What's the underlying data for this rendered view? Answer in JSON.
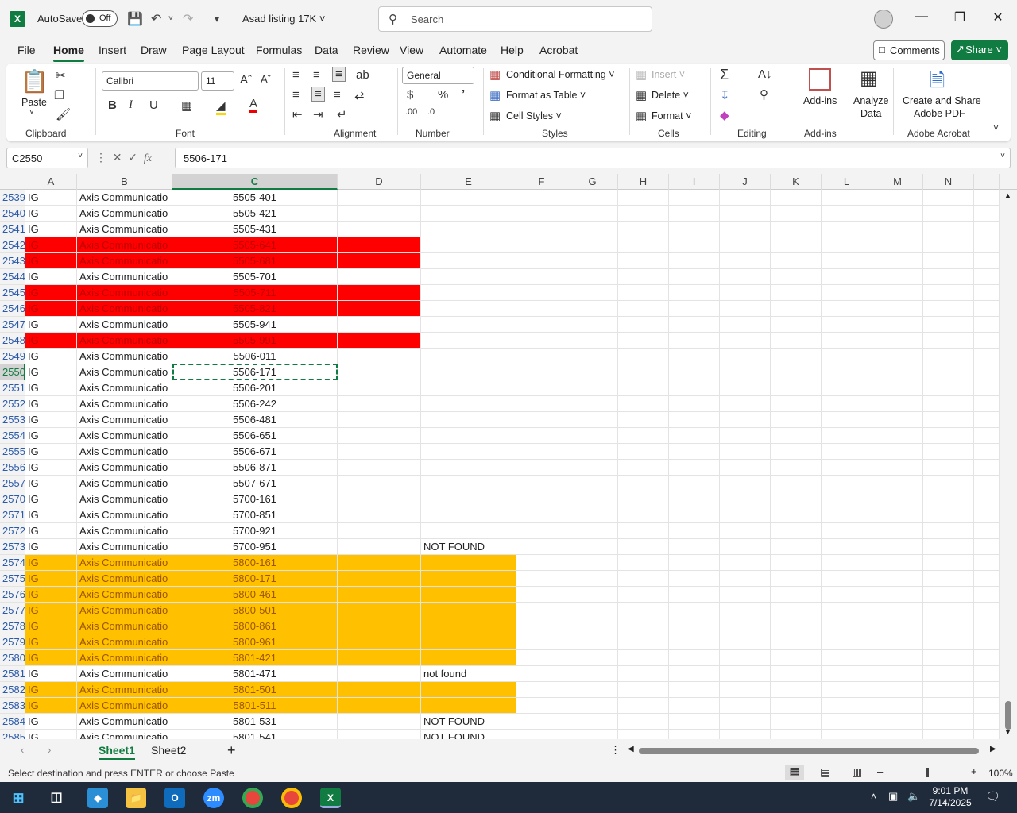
{
  "title": {
    "autosave_label": "AutoSave",
    "autosave_state": "Off",
    "doc_title": "Asad listing 17K",
    "search_placeholder": "Search"
  },
  "menu": {
    "tabs": [
      "File",
      "Home",
      "Insert",
      "Draw",
      "Page Layout",
      "Formulas",
      "Data",
      "Review",
      "View",
      "Automate",
      "Help",
      "Acrobat"
    ],
    "active": "Home",
    "comments": "Comments",
    "share": "Share"
  },
  "ribbon": {
    "clipboard": {
      "label": "Clipboard",
      "paste": "Paste"
    },
    "font": {
      "label": "Font",
      "name": "Calibri",
      "size": "11"
    },
    "alignment": {
      "label": "Alignment"
    },
    "number": {
      "label": "Number",
      "format": "General"
    },
    "styles": {
      "label": "Styles",
      "conditional": "Conditional Formatting",
      "format_table": "Format as Table",
      "cell_styles": "Cell Styles"
    },
    "cells": {
      "label": "Cells",
      "insert": "Insert",
      "delete": "Delete",
      "format": "Format"
    },
    "editing": {
      "label": "Editing"
    },
    "addins": {
      "label": "Add-ins",
      "addins_btn": "Add-ins",
      "analyze_line1": "Analyze",
      "analyze_line2": "Data"
    },
    "acrobat": {
      "label": "Adobe Acrobat",
      "line1": "Create and Share",
      "line2": "Adobe PDF"
    }
  },
  "formula_bar": {
    "name_box": "C2550",
    "fx": "fx",
    "value": "5506-171"
  },
  "columns": [
    "A",
    "B",
    "C",
    "D",
    "E",
    "F",
    "G",
    "H",
    "I",
    "J",
    "K",
    "L",
    "M",
    "N"
  ],
  "selected_column": "C",
  "selected_row": "2550",
  "rows": [
    {
      "n": "2539",
      "a": "IG",
      "b": "Axis Communicatio",
      "c": "5505-401",
      "e": "",
      "hl": ""
    },
    {
      "n": "2540",
      "a": "IG",
      "b": "Axis Communicatio",
      "c": "5505-421",
      "e": "",
      "hl": ""
    },
    {
      "n": "2541",
      "a": "IG",
      "b": "Axis Communicatio",
      "c": "5505-431",
      "e": "",
      "hl": ""
    },
    {
      "n": "2542",
      "a": "IG",
      "b": "Axis Communicatio",
      "c": "5505-641",
      "e": "",
      "hl": "red"
    },
    {
      "n": "2543",
      "a": "IG",
      "b": "Axis Communicatio",
      "c": "5505-681",
      "e": "",
      "hl": "red"
    },
    {
      "n": "2544",
      "a": "IG",
      "b": "Axis Communicatio",
      "c": "5505-701",
      "e": "",
      "hl": ""
    },
    {
      "n": "2545",
      "a": "IG",
      "b": "Axis Communicatio",
      "c": "5505-711",
      "e": "",
      "hl": "red"
    },
    {
      "n": "2546",
      "a": "IG",
      "b": "Axis Communicatio",
      "c": "5505-821",
      "e": "",
      "hl": "red"
    },
    {
      "n": "2547",
      "a": "IG",
      "b": "Axis Communicatio",
      "c": "5505-941",
      "e": "",
      "hl": ""
    },
    {
      "n": "2548",
      "a": "IG",
      "b": "Axis Communicatio",
      "c": "5505-991",
      "e": "",
      "hl": "red"
    },
    {
      "n": "2549",
      "a": "IG",
      "b": "Axis Communicatio",
      "c": "5506-011",
      "e": "",
      "hl": ""
    },
    {
      "n": "2550",
      "a": "IG",
      "b": "Axis Communicatio",
      "c": "5506-171",
      "e": "",
      "hl": ""
    },
    {
      "n": "2551",
      "a": "IG",
      "b": "Axis Communicatio",
      "c": "5506-201",
      "e": "",
      "hl": ""
    },
    {
      "n": "2552",
      "a": "IG",
      "b": "Axis Communicatio",
      "c": "5506-242",
      "e": "",
      "hl": ""
    },
    {
      "n": "2553",
      "a": "IG",
      "b": "Axis Communicatio",
      "c": "5506-481",
      "e": "",
      "hl": ""
    },
    {
      "n": "2554",
      "a": "IG",
      "b": "Axis Communicatio",
      "c": "5506-651",
      "e": "",
      "hl": ""
    },
    {
      "n": "2555",
      "a": "IG",
      "b": "Axis Communicatio",
      "c": "5506-671",
      "e": "",
      "hl": ""
    },
    {
      "n": "2556",
      "a": "IG",
      "b": "Axis Communicatio",
      "c": "5506-871",
      "e": "",
      "hl": ""
    },
    {
      "n": "2557",
      "a": "IG",
      "b": "Axis Communicatio",
      "c": "5507-671",
      "e": "",
      "hl": ""
    },
    {
      "n": "2570",
      "a": "IG",
      "b": "Axis Communicatio",
      "c": "5700-161",
      "e": "",
      "hl": ""
    },
    {
      "n": "2571",
      "a": "IG",
      "b": "Axis Communicatio",
      "c": "5700-851",
      "e": "",
      "hl": ""
    },
    {
      "n": "2572",
      "a": "IG",
      "b": "Axis Communicatio",
      "c": "5700-921",
      "e": "",
      "hl": ""
    },
    {
      "n": "2573",
      "a": "IG",
      "b": "Axis Communicatio",
      "c": "5700-951",
      "e": "NOT FOUND",
      "hl": ""
    },
    {
      "n": "2574",
      "a": "IG",
      "b": "Axis Communicatio",
      "c": "5800-161",
      "e": "",
      "hl": "orange"
    },
    {
      "n": "2575",
      "a": "IG",
      "b": "Axis Communicatio",
      "c": "5800-171",
      "e": "",
      "hl": "orange"
    },
    {
      "n": "2576",
      "a": "IG",
      "b": "Axis Communicatio",
      "c": "5800-461",
      "e": "",
      "hl": "orange"
    },
    {
      "n": "2577",
      "a": "IG",
      "b": "Axis Communicatio",
      "c": "5800-501",
      "e": "",
      "hl": "orange"
    },
    {
      "n": "2578",
      "a": "IG",
      "b": "Axis Communicatio",
      "c": "5800-861",
      "e": "",
      "hl": "orange"
    },
    {
      "n": "2579",
      "a": "IG",
      "b": "Axis Communicatio",
      "c": "5800-961",
      "e": "",
      "hl": "orange"
    },
    {
      "n": "2580",
      "a": "IG",
      "b": "Axis Communicatio",
      "c": "5801-421",
      "e": "",
      "hl": "orange"
    },
    {
      "n": "2581",
      "a": "IG",
      "b": "Axis Communicatio",
      "c": "5801-471",
      "e": "not found",
      "hl": ""
    },
    {
      "n": "2582",
      "a": "IG",
      "b": "Axis Communicatio",
      "c": "5801-501",
      "e": "",
      "hl": "orange"
    },
    {
      "n": "2583",
      "a": "IG",
      "b": "Axis Communicatio",
      "c": "5801-511",
      "e": "",
      "hl": "orange"
    },
    {
      "n": "2584",
      "a": "IG",
      "b": "Axis Communicatio",
      "c": "5801-531",
      "e": "NOT FOUND",
      "hl": ""
    },
    {
      "n": "2585",
      "a": "IG",
      "b": "Axis Communicatio",
      "c": "5801-541",
      "e": "NOT FOUND",
      "hl": ""
    }
  ],
  "highlight_colors": {
    "red": "#ff0000",
    "orange": "#ffc000",
    "accent": "#107c41"
  },
  "sheets": [
    "Sheet1",
    "Sheet2"
  ],
  "active_sheet": "Sheet1",
  "status": {
    "message": "Select destination and press ENTER or choose Paste",
    "zoom": "100%"
  },
  "taskbar": {
    "time": "9:01 PM",
    "date": "7/14/2025",
    "apps": [
      "start-icon",
      "task-view-icon",
      "vscode-like-icon",
      "file-explorer-icon",
      "outlook-icon",
      "zoom-icon",
      "chrome-icon",
      "chrome-profile-icon",
      "excel-icon"
    ]
  }
}
